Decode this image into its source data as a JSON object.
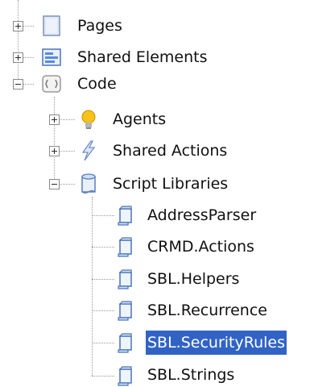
{
  "tree": {
    "pages": {
      "label": "Pages",
      "icon": "page-icon"
    },
    "shared_elements": {
      "label": "Shared Elements",
      "icon": "shared-elements-icon"
    },
    "code": {
      "label": "Code",
      "icon": "code-icon",
      "children": {
        "agents": {
          "label": "Agents",
          "icon": "lightbulb-icon"
        },
        "shared_actions": {
          "label": "Shared Actions",
          "icon": "lightning-icon"
        },
        "script_libraries": {
          "label": "Script Libraries",
          "icon": "script-library-icon",
          "items": [
            {
              "label": "AddressParser",
              "icon": "script-icon"
            },
            {
              "label": "CRMD.Actions",
              "icon": "script-icon"
            },
            {
              "label": "SBL.Helpers",
              "icon": "script-icon"
            },
            {
              "label": "SBL.Recurrence",
              "icon": "script-icon"
            },
            {
              "label": "SBL.SecurityRules",
              "icon": "script-icon",
              "selected": true
            },
            {
              "label": "SBL.Strings",
              "icon": "script-icon"
            }
          ]
        }
      }
    }
  },
  "colors": {
    "selection": "#3163c5",
    "selection_text": "#ffffff"
  }
}
